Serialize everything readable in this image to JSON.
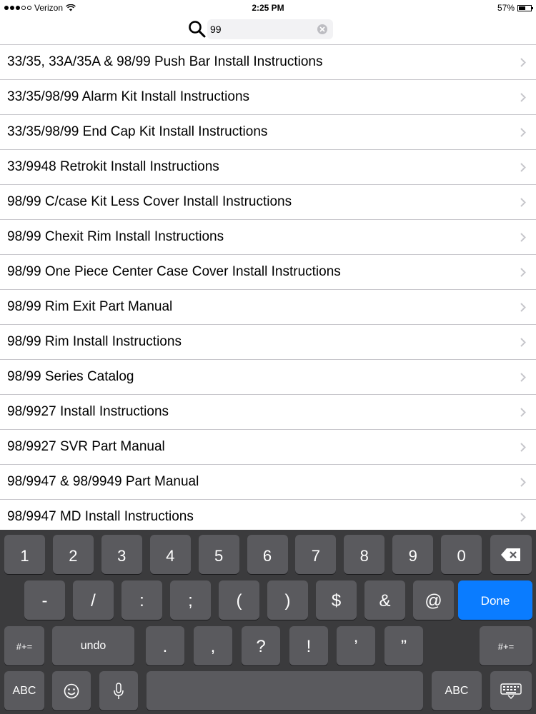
{
  "status_bar": {
    "carrier": "Verizon",
    "time": "2:25 PM",
    "battery": "57%",
    "battery_level": 0.57
  },
  "search": {
    "value": "99"
  },
  "results": [
    "33/35, 33A/35A & 98/99 Push Bar Install Instructions",
    "33/35/98/99 Alarm Kit Install Instructions",
    "33/35/98/99 End Cap Kit Install Instructions",
    "33/9948 Retrokit Install Instructions",
    "98/99 C/case Kit Less Cover Install Instructions",
    "98/99 Chexit Rim Install Instructions",
    "98/99 One Piece Center Case Cover Install Instructions",
    "98/99 Rim Exit Part Manual",
    "98/99 Rim Install Instructions",
    "98/99 Series Catalog",
    "98/9927 Install Instructions",
    "98/9927 SVR Part Manual",
    "98/9947 & 98/9949 Part Manual",
    "98/9947 MD Install Instructions"
  ],
  "keyboard": {
    "row1": [
      "1",
      "2",
      "3",
      "4",
      "5",
      "6",
      "7",
      "8",
      "9",
      "0"
    ],
    "row2": [
      "-",
      "/",
      ":",
      ";",
      "(",
      ")",
      "$",
      "&",
      "@"
    ],
    "row3": [
      ".",
      ",",
      "?",
      "!",
      "’",
      "”"
    ],
    "done_label": "Done",
    "shift_label": "#+=",
    "undo_label": "undo",
    "abc_label": "ABC",
    "delete_icon": "backspace-icon",
    "emoji_icon": "emoji-icon",
    "mic_icon": "microphone-icon",
    "hide_icon": "keyboard-hide-icon"
  },
  "colors": {
    "done_blue": "#0a7cff",
    "keyboard_bg": "#2c2c2e",
    "separator": "#c8c7cc"
  }
}
